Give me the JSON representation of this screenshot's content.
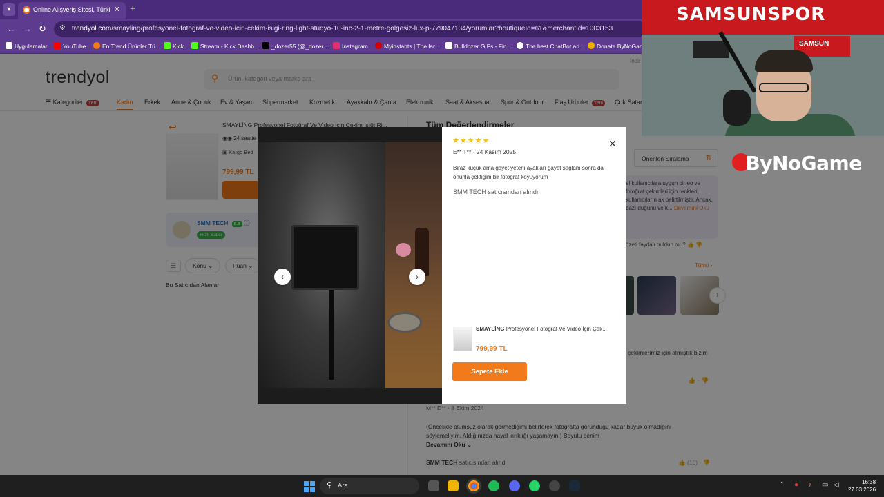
{
  "browser": {
    "tab_title": "Online Alışveriş Sitesi, Türkiye'nin...",
    "url_host": "trendyol.com",
    "url_path": "/smayling/profesyonel-fotograf-ve-video-icin-cekim-isigi-ring-light-studyo-10-inc-2-1-metre-golgesiz-lux-p-779047134/yorumlar?boutiqueId=61&merchantId=1003153",
    "bookmarks": [
      "Uygulamalar",
      "YouTube",
      "En Trend Ürünler Tü...",
      "Kick",
      "Stream - Kick Dashb...",
      "_dozer55 (@_dozer...",
      "Instagram",
      "Myinstants | The lar...",
      "Bulldozer GIFs - Fin...",
      "The best ChatBot an...",
      "Donate ByNoGam"
    ]
  },
  "page": {
    "logo": "trendyol",
    "search_placeholder": "Ürün, kategori veya marka ara",
    "indir": "İndir",
    "nav": [
      "Kategoriler",
      "Kadın",
      "Erkek",
      "Anne & Çocuk",
      "Ev & Yaşam",
      "Süpermarket",
      "Kozmetik",
      "Ayakkabı & Çanta",
      "Elektronik",
      "Saat & Aksesuar",
      "Spor & Outdoor",
      "Flaş Ürünler",
      "Çok Satan"
    ],
    "new_badge": "Yeni",
    "product": {
      "name": "SMAYLİNG Profesyonel Fotoğraf Ve Video İçin Çekim Işığı Ri...",
      "delivery": "24 saatte",
      "kargo": "Kargo Bed",
      "price": "799,99 TL"
    },
    "seller": {
      "name": "SMM TECH",
      "score": "8.8",
      "tag": "Hızlı Satıcı"
    },
    "filters": [
      "Konu",
      "Puan"
    ],
    "seller_filter": "Bu Satıcıdan Alanlar",
    "reviews_title": "Tüm Değerlendirmeler",
    "sort_label": "Önerilen Sıralama",
    "ai_summary": "el kullanıcılara uygun bir eo ve fotoğraf çekimleri için renkleri, kullanıcıların ak belirtilmiştir. Ancak, bazı duğunu ve k...",
    "ai_more": "Devamını Oku",
    "helpful_q": "özeti faydalı buldun mu?",
    "tumu": "Tümü",
    "review_snippet": "ip çekimlerimiz için almıştık bizim",
    "review2": {
      "author": "M** D**",
      "date": "8 Ekim 2024",
      "body": "(Öncelikle olumsuz olarak görmediğimi belirterek fotoğrafta göründüğü kadar büyük olmadığını söylemeliyim. Aldığınızda hayal kırıklığı yaşamayın.) Boyutu benim",
      "more": "Devamını Oku",
      "seller": "SMM TECH",
      "seller_suffix": "satıcısından alındı",
      "likes": "(10)"
    }
  },
  "modal": {
    "stars": "★★★★★",
    "author": "E** T**",
    "date": "24 Kasım 2025",
    "text": "Biraz küçük ama gayet yeterli ayakları gayet sağlam sonra da onunla çektiğim bir fotoğraf koyuyorum",
    "seller_line": "SMM TECH satıcısından alındı",
    "product_brand": "SMAYLİNG",
    "product_name": "Profesyonel Fotoğraf Ve Video İçin Çek...",
    "product_price": "799,99 TL",
    "add_to_cart": "Sepete Ekle"
  },
  "webcam": {
    "scarf": "SAMSUNSPOR",
    "flag": "SAMSUN"
  },
  "stream_logo": "ByNoGame",
  "taskbar": {
    "search": "Ara",
    "time": "16:38",
    "date": "27.03.2026"
  },
  "colors": {
    "accent": "#f27a1a",
    "browser": "#5d3b8f",
    "star": "#f2c21a"
  }
}
